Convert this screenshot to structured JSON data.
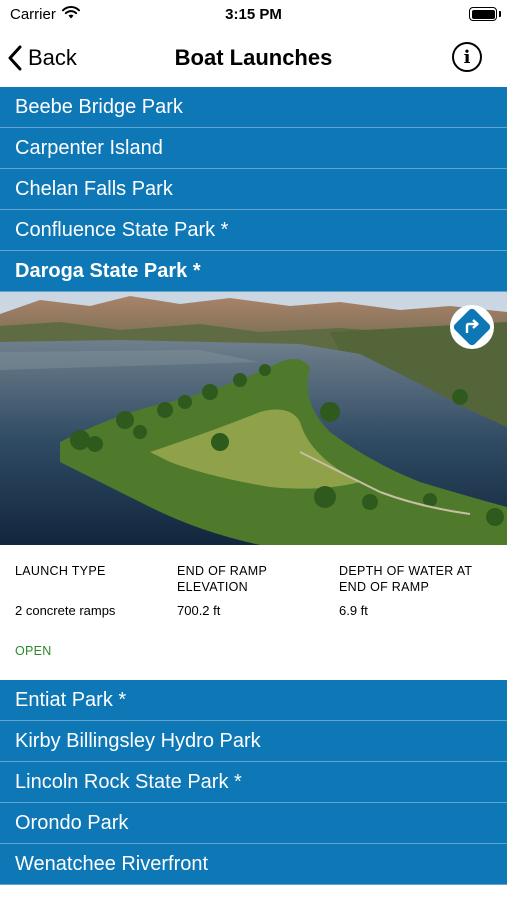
{
  "status_bar": {
    "carrier": "Carrier",
    "time": "3:15 PM",
    "icons": [
      "wifi-icon",
      "battery-icon"
    ]
  },
  "nav": {
    "back_label": "Back",
    "title": "Boat Launches",
    "info_label": "i"
  },
  "list_top": [
    {
      "label": "Beebe Bridge Park"
    },
    {
      "label": "Carpenter Island"
    },
    {
      "label": "Chelan Falls Park"
    },
    {
      "label": "Confluence State Park *"
    },
    {
      "label": "Daroga State Park *",
      "selected": true
    }
  ],
  "detail": {
    "image_alt": "Aerial view of Daroga State Park peninsula on the river",
    "directions_icon": "directions-icon",
    "columns": [
      {
        "label": "LAUNCH TYPE",
        "value": "2 concrete ramps"
      },
      {
        "label": "END OF RAMP ELEVATION",
        "value": "700.2 ft"
      },
      {
        "label": "DEPTH OF WATER AT END OF RAMP",
        "value": "6.9 ft"
      }
    ],
    "status": "OPEN"
  },
  "list_bottom": [
    {
      "label": "Entiat Park *"
    },
    {
      "label": "Kirby Billingsley Hydro Park"
    },
    {
      "label": "Lincoln Rock State Park *"
    },
    {
      "label": "Orondo Park"
    },
    {
      "label": "Wenatchee Riverfront"
    }
  ],
  "colors": {
    "accent": "#0e77b6",
    "open_status": "#2d8a2d"
  }
}
